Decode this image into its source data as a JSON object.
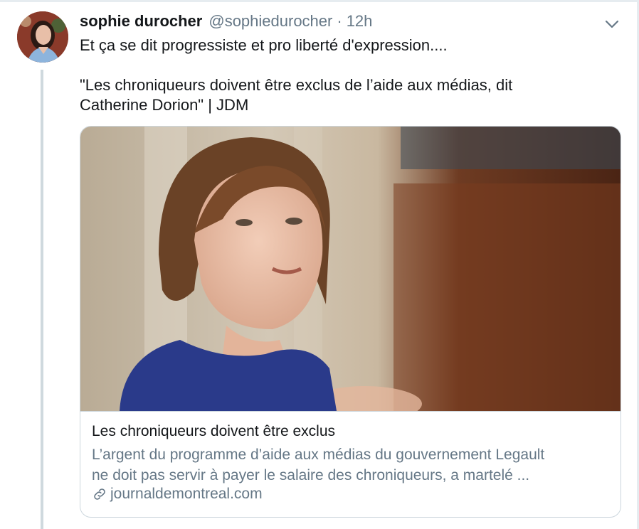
{
  "tweet": {
    "author_name": "sophie durocher",
    "author_handle": "@sophiedurocher",
    "separator": "·",
    "timestamp": "12h",
    "text_line1": "Et ça se dit progressiste et pro liberté d'expression....",
    "text_line2": "\"Les chroniqueurs doivent être exclus de l’aide aux médias, dit",
    "text_line3": "Catherine Dorion\" | JDM"
  },
  "card": {
    "title": "Les chroniqueurs doivent être exclus",
    "description_line1": "L’argent du programme d’aide aux médias du gouvernement Legault",
    "description_line2": "ne doit pas servir à payer le salaire des chroniqueurs, a martelé ...",
    "domain": "journaldemontreal.com"
  },
  "icons": {
    "menu": "chevron-down-icon",
    "link": "link-icon"
  },
  "colors": {
    "text_primary": "#14171a",
    "text_secondary": "#657786",
    "border": "#ccd6dd",
    "thread_line": "#cfd9de"
  }
}
